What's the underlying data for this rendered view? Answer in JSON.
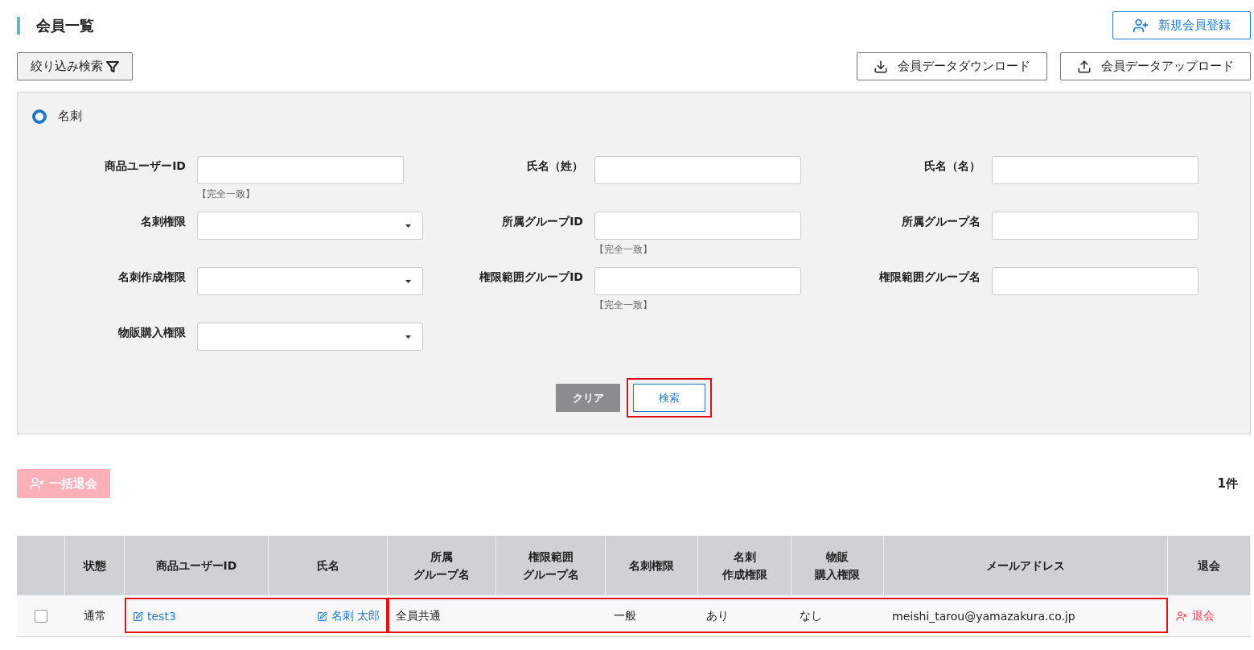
{
  "title": "会員一覧",
  "new_member_button": {
    "label": "新規会員登録"
  },
  "filter_button": {
    "label": "絞り込み検索"
  },
  "download_button": {
    "label": "会員データダウンロード"
  },
  "upload_button": {
    "label": "会員データアップロード"
  },
  "radio": {
    "label": "名刺",
    "selected": true
  },
  "fields": [
    {
      "label": "商品ユーザーID",
      "kind": "text",
      "hint": "【完全一致】"
    },
    {
      "label": "氏名（姓）",
      "kind": "text"
    },
    {
      "label": "氏名（名）",
      "kind": "text"
    },
    {
      "label": "名刺権限",
      "kind": "select"
    },
    {
      "label": "所属グループID",
      "kind": "text",
      "hint": "【完全一致】"
    },
    {
      "label": "所属グループ名",
      "kind": "text"
    },
    {
      "label": "名刺作成権限",
      "kind": "select"
    },
    {
      "label": "権限範囲グループID",
      "kind": "text",
      "hint": "【完全一致】"
    },
    {
      "label": "権限範囲グループ名",
      "kind": "text"
    },
    {
      "label": "物販購入権限",
      "kind": "select"
    }
  ],
  "clear_button": {
    "label": "クリア"
  },
  "search_button": {
    "label": "検索",
    "highlighted": true
  },
  "bulk_withdraw_button": {
    "label": "一括退会",
    "disabled": true
  },
  "count": "1件",
  "table": {
    "columns": [
      [],
      [
        "状態"
      ],
      [
        "商品ユーザーID"
      ],
      [
        "氏名"
      ],
      [
        "所属",
        "グループ名"
      ],
      [
        "権限範囲",
        "グループ名"
      ],
      [
        "名刺権限"
      ],
      [
        "名刺",
        "作成権限"
      ],
      [
        "物販",
        "購入権限"
      ],
      [
        "メールアドレス"
      ],
      [
        "退会"
      ]
    ],
    "rows": [
      {
        "groups": [
          {
            "highlighted": false,
            "cells": [
              {
                "kind": "checkbox",
                "checked": false
              },
              {
                "kind": "text",
                "text": "通常"
              }
            ]
          },
          {
            "highlighted": true,
            "cells": [
              {
                "kind": "link",
                "text": "test3"
              },
              {
                "kind": "link",
                "text": "名刺 太郎"
              }
            ]
          },
          {
            "highlighted": true,
            "cells": [
              {
                "kind": "text",
                "text": "全員共通"
              },
              {
                "kind": "empty"
              },
              {
                "kind": "text",
                "text": "一般"
              },
              {
                "kind": "text",
                "text": "あり"
              },
              {
                "kind": "text",
                "text": "なし"
              },
              {
                "kind": "text",
                "text": "meishi_tarou@yamazakura.co.jp"
              }
            ]
          },
          {
            "highlighted": false,
            "cells": [
              {
                "kind": "action",
                "text": "退会"
              }
            ]
          }
        ]
      }
    ]
  }
}
